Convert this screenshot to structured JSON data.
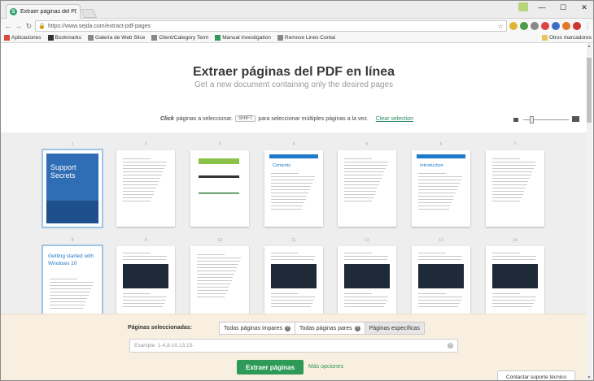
{
  "browser": {
    "tab_title": "Extraer páginas del PDF ×",
    "tab_close": "×",
    "url": "https://www.sejda.com/extract-pdf-pages",
    "window_controls": [
      "—",
      "☐",
      "✕"
    ],
    "nav": {
      "back": "←",
      "forward": "→",
      "reload": "↻",
      "star": "☆",
      "menu": "⋮"
    }
  },
  "bookmarks": {
    "items": [
      {
        "label": "Aplicaciones",
        "icon": "apps-grid-icon",
        "color": "#d84b3b"
      },
      {
        "label": "Bookmarks",
        "icon": "star-icon",
        "color": "#333333"
      },
      {
        "label": "Galería de Web Slice",
        "icon": "page-icon",
        "color": "#888888"
      },
      {
        "label": "Client/Category Term",
        "icon": "page-icon",
        "color": "#888888"
      },
      {
        "label": "Manual Investigation",
        "icon": "green-square-icon",
        "color": "#2f9a55"
      },
      {
        "label": "Remove Lines Contai",
        "icon": "page-icon",
        "color": "#888888"
      }
    ],
    "other": "Otros marcadores"
  },
  "page": {
    "title": "Extraer páginas del PDF en línea",
    "subtitle": "Get a new document containing only the desired pages",
    "instruction_click": "Click",
    "instruction_text1": "páginas a seleccionar.",
    "instruction_key": "SHIFT",
    "instruction_text2": "para seleccionar múltiples páginas a la vez.",
    "clear_selection": "Clear selection"
  },
  "thumbnails": [
    {
      "num": "1",
      "kind": "cover",
      "title": "Support Secrets",
      "selected": true
    },
    {
      "num": "2",
      "kind": "text"
    },
    {
      "num": "3",
      "kind": "diagram"
    },
    {
      "num": "4",
      "kind": "contents",
      "title": "Contents"
    },
    {
      "num": "5",
      "kind": "text"
    },
    {
      "num": "6",
      "kind": "contents",
      "title": "Introduction"
    },
    {
      "num": "7",
      "kind": "text"
    },
    {
      "num": "8",
      "kind": "heading",
      "title": "Getting started with Windows 10",
      "selected": true
    },
    {
      "num": "9",
      "kind": "screenshot"
    },
    {
      "num": "10",
      "kind": "text"
    },
    {
      "num": "11",
      "kind": "screenshot"
    },
    {
      "num": "12",
      "kind": "screenshot"
    },
    {
      "num": "13",
      "kind": "screenshot"
    },
    {
      "num": "14",
      "kind": "screenshot"
    }
  ],
  "panel": {
    "label": "Páginas seleccionadas:",
    "options": [
      {
        "label": "Todas páginas impares",
        "info": "?"
      },
      {
        "label": "Todas páginas pares",
        "info": "?"
      },
      {
        "label": "Páginas específicas",
        "info": ""
      }
    ],
    "input_placeholder": "Example: 1-4,8-10,13,15-",
    "extract_button": "Extraer páginas",
    "more_options": "Más opciones",
    "support": "Contactar soporte técnico"
  },
  "colors": {
    "accent_green": "#2d9a57",
    "link_green": "#2a8a5e",
    "panel_bg": "#f9efe0",
    "grid_bg": "#eeeeee"
  }
}
